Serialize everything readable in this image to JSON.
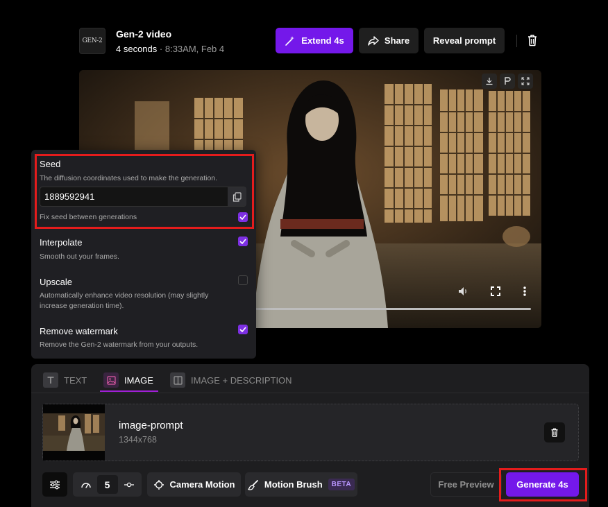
{
  "header": {
    "logo_text": "GEN-2",
    "title": "Gen-2 video",
    "duration": "4 seconds",
    "separator": "·",
    "timestamp": "8:33AM, Feb 4",
    "extend_label": "Extend 4s",
    "share_label": "Share",
    "reveal_label": "Reveal prompt"
  },
  "video": {
    "toolbar_icons": [
      "download-icon",
      "pin-icon",
      "fullscreen-icon"
    ],
    "controls_icons": [
      "volume-icon",
      "fullscreen-icon",
      "more-icon"
    ]
  },
  "settings": {
    "seed": {
      "label": "Seed",
      "description": "The diffusion coordinates used to make the generation.",
      "value": "1889592941",
      "fix_label": "Fix seed between generations",
      "fix_checked": true
    },
    "interpolate": {
      "label": "Interpolate",
      "description": "Smooth out your frames.",
      "checked": true
    },
    "upscale": {
      "label": "Upscale",
      "description_line1": "Automatically enhance video resolution (may slightly",
      "description_line2": "increase generation time).",
      "checked": false
    },
    "watermark": {
      "label": "Remove watermark",
      "description": "Remove the Gen-2 watermark from your outputs.",
      "checked": true
    }
  },
  "tabs": [
    {
      "label": "TEXT",
      "active": false
    },
    {
      "label": "IMAGE",
      "active": true
    },
    {
      "label": "IMAGE + DESCRIPTION",
      "active": false
    }
  ],
  "image_prompt": {
    "name": "image-prompt",
    "size": "1344x768"
  },
  "toolbar": {
    "motion_value": "5",
    "camera_motion_label": "Camera Motion",
    "motion_brush_label": "Motion Brush",
    "beta_label": "BETA",
    "free_preview_label": "Free Preview",
    "generate_label": "Generate 4s"
  },
  "colors": {
    "accent": "#7418ea",
    "highlight": "#e41c1c",
    "checkbox": "#7d2fe3"
  }
}
